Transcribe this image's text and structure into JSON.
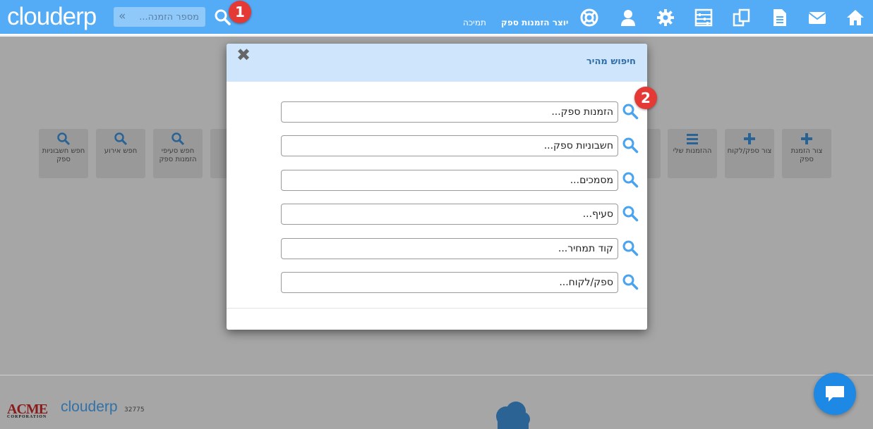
{
  "topbar": {
    "logo": "clouderp",
    "order_search_placeholder": "מספר הזמנה...",
    "nav_support": "תמיכה",
    "nav_creator": "יוצר הזמנות ספק",
    "badge1": "1"
  },
  "tiles": [
    {
      "label": "צור הזמנת ספק",
      "icon": "plus-icon"
    },
    {
      "label": "צור ספק/לקוח",
      "icon": "plus-icon"
    },
    {
      "label": "ההזמנות שלי",
      "icon": "list-icon"
    },
    {
      "label": "חפש סעיפי הזמנות ספק",
      "icon": "search-icon"
    },
    {
      "label": "חפש אירוע",
      "icon": "search-icon"
    },
    {
      "label": "חפש חשבוניות ספק",
      "icon": "search-icon"
    }
  ],
  "modal": {
    "title": "חיפוש מהיר",
    "close": "✖",
    "badge2": "2",
    "fields": [
      {
        "placeholder": "הזמנות ספק..."
      },
      {
        "placeholder": "חשבוניות ספק..."
      },
      {
        "placeholder": "מסמכים..."
      },
      {
        "placeholder": "סעיף..."
      },
      {
        "placeholder": "קוד תמחיר..."
      },
      {
        "placeholder": "ספק/לקוח..."
      }
    ]
  },
  "footer": {
    "acme": "ACME",
    "acme_sub": "CORPORATION",
    "logo": "clouderp",
    "number": "32775"
  },
  "colors": {
    "topbar": "#55acf6",
    "accent": "#4aa3ee",
    "badge": "#e53935"
  }
}
